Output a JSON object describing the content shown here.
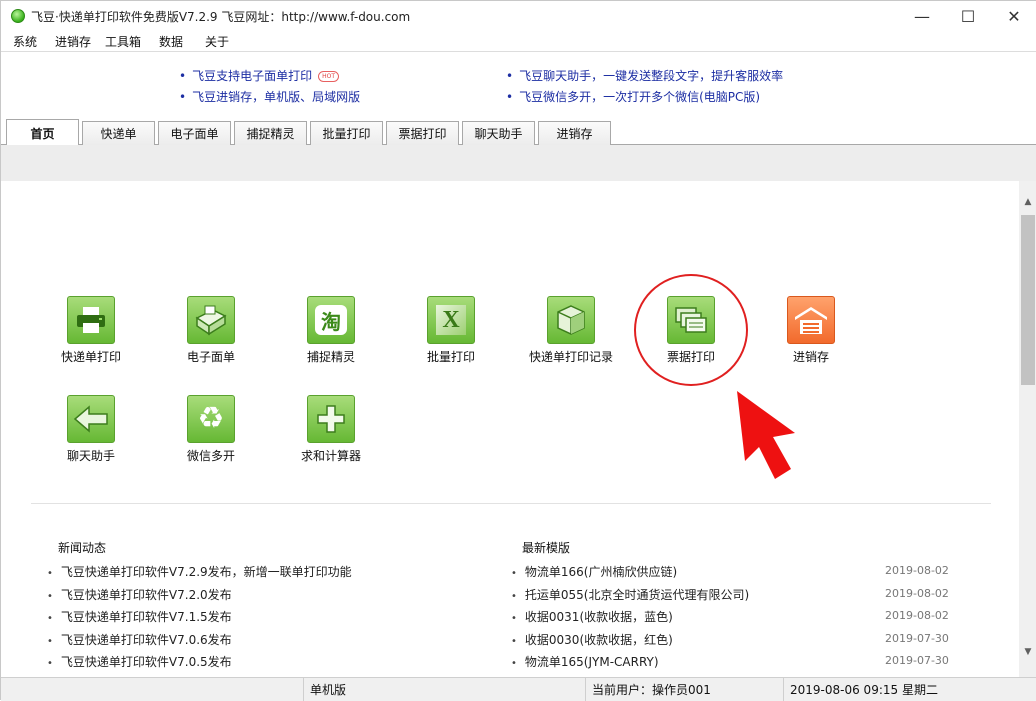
{
  "window": {
    "title": "飞豆·快递单打印软件免费版V7.2.9  飞豆网址：http://www.f-dou.com",
    "minimize": "—",
    "maximize": "☐",
    "close": "✕"
  },
  "menu": [
    "系统",
    "进销存",
    "工具箱",
    "数据",
    "关于"
  ],
  "ads": [
    {
      "text": "飞豆支持电子面单打印",
      "hot": "HOT"
    },
    {
      "text": "飞豆进销存，单机版、局域网版"
    },
    {
      "text": "飞豆聊天助手，一键发送整段文字，提升客服效率"
    },
    {
      "text": "飞豆微信多开，一次打开多个微信(电脑PC版)"
    }
  ],
  "tabs": [
    "首页",
    "快递单",
    "电子面单",
    "捕捉精灵",
    "批量打印",
    "票据打印",
    "聊天助手",
    "进销存"
  ],
  "tiles": [
    {
      "label": "快递单打印",
      "icon": "printer-icon"
    },
    {
      "label": "电子面单",
      "icon": "label-printer-icon"
    },
    {
      "label": "捕捉精灵",
      "icon": "taobao-icon",
      "glyph": "淘"
    },
    {
      "label": "批量打印",
      "icon": "excel-icon",
      "glyph": "X"
    },
    {
      "label": "快递单打印记录",
      "icon": "package-icon"
    },
    {
      "label": "票据打印",
      "icon": "receipt-stack-icon"
    },
    {
      "label": "进销存",
      "icon": "warehouse-icon"
    },
    {
      "label": "聊天助手",
      "icon": "arrow-left-icon"
    },
    {
      "label": "微信多开",
      "icon": "recycle-icon",
      "glyph": "♻"
    },
    {
      "label": "求和计算器",
      "icon": "plus-icon",
      "glyph": "+"
    }
  ],
  "news": {
    "title": "新闻动态",
    "items": [
      "飞豆快递单打印软件V7.2.9发布，新增一联单打印功能",
      "飞豆快递单打印软件V7.2.0发布",
      "飞豆快递单打印软件V7.1.5发布",
      "飞豆快递单打印软件V7.0.6发布",
      "飞豆快递单打印软件V7.0.5发布"
    ]
  },
  "templates": {
    "title": "最新模版",
    "items": [
      {
        "name": "物流单166(广州楠欣供应链)",
        "date": "2019-08-02"
      },
      {
        "name": "托运单055(北京全时通货运代理有限公司)",
        "date": "2019-08-02"
      },
      {
        "name": "收据0031(收款收据，蓝色)",
        "date": "2019-08-02"
      },
      {
        "name": "收据0030(收款收据，红色)",
        "date": "2019-07-30"
      },
      {
        "name": "物流单165(JYM-CARRY)",
        "date": "2019-07-30"
      }
    ]
  },
  "status": {
    "mode": "单机版",
    "user": "当前用户：操作员001",
    "datetime": "2019-08-06 09:15 星期二"
  },
  "colors": {
    "link": "#1d2ea3",
    "tile_green": "#66b834",
    "tile_orange": "#f26a2c",
    "highlight": "#e02020"
  }
}
